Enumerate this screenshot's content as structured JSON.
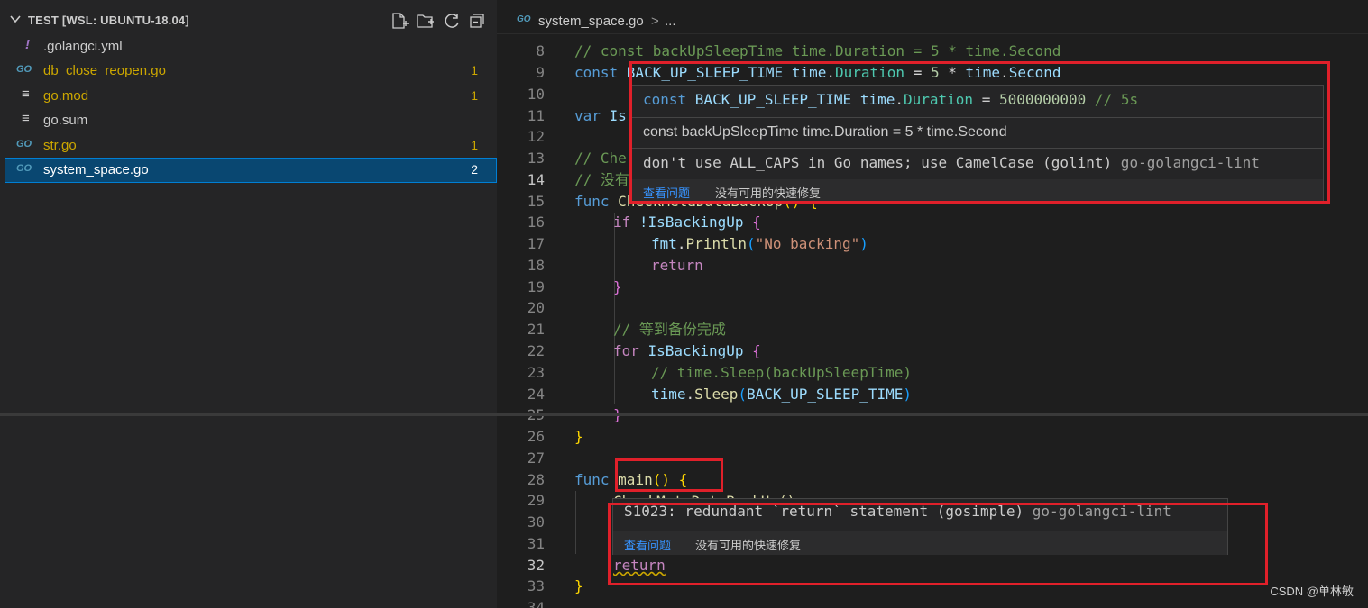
{
  "explorer": {
    "title": "TEST [WSL: UBUNTU-18.04]",
    "files": [
      {
        "icon": "!",
        "name": ".golangci.yml",
        "badge": "",
        "color": "#cccccc"
      },
      {
        "icon": "GO",
        "name": "db_close_reopen.go",
        "badge": "1",
        "color": "#cca700"
      },
      {
        "icon": "≡",
        "name": "go.mod",
        "badge": "1",
        "color": "#cca700"
      },
      {
        "icon": "≡",
        "name": "go.sum",
        "badge": "",
        "color": "#cccccc"
      },
      {
        "icon": "GO",
        "name": "str.go",
        "badge": "1",
        "color": "#cca700"
      },
      {
        "icon": "GO",
        "name": "system_space.go",
        "badge": "2",
        "color": "#ffffff"
      }
    ]
  },
  "tab": {
    "go_icon": "GO",
    "filename": "system_space.go",
    "separator": ">",
    "ellipsis": "..."
  },
  "line_numbers": [
    "8",
    "9",
    "10",
    "11",
    "12",
    "13",
    "14",
    "15",
    "16",
    "17",
    "18",
    "19",
    "20",
    "21",
    "22",
    "23",
    "24",
    "25",
    "26",
    "27",
    "28",
    "29",
    "30",
    "31",
    "32",
    "33",
    "34"
  ],
  "code": {
    "l8": "// const backUpSleepTime time.Duration = 5 * time.Second",
    "l9_kw": "const ",
    "l9_name": "BACK_UP_SLEEP_TIME",
    "l9_type_pkg": "time",
    "l9_type": "Duration",
    "l9_eq": " = ",
    "l9_num": "5",
    "l9_mul": " * ",
    "l9_pkg": "time",
    "l9_sec": "Second",
    "l11_kw": "var ",
    "l11_name": "Is",
    "l13": "// Che",
    "l14": "// 没有",
    "l15_kw": "func ",
    "l15_name": "CheckMetaDataBackUp",
    "l15_rest": "() {",
    "l16_kw": "if ",
    "l16_rest": "!IsBackingUp ",
    "l16_brace": "{",
    "l17_pkg": "fmt",
    "l17_fn": "Println",
    "l17_str": "\"No backing\"",
    "l18": "return",
    "l19": "}",
    "l21": "// 等到备份完成",
    "l22_kw": "for ",
    "l22_name": "IsBackingUp ",
    "l22_brace": "{",
    "l23": "// time.Sleep(backUpSleepTime)",
    "l24_pkg": "time",
    "l24_fn": "Sleep",
    "l24_arg": "BACK_UP_SLEEP_TIME",
    "l25": "}",
    "l26": "}",
    "l28_kw": "func ",
    "l28_fn": "main",
    "l28_paren": "()",
    "l28_brace": "{",
    "l29": "CheckMetaDataBackUp()",
    "l32": "return",
    "l33": "}"
  },
  "hover1": {
    "sig_kw": "const ",
    "sig_name": "BACK_UP_SLEEP_TIME ",
    "sig_type_pkg": "time",
    "sig_type": "Duration",
    "sig_eq": " = ",
    "sig_num": "5000000000",
    "sig_comment": " // 5s",
    "doc": "const backUpSleepTime time.Duration = 5 * time.Second",
    "problem": "don't use ALL_CAPS in Go names; use CamelCase (golint)",
    "source": " go-golangci-lint",
    "view_problem": "查看问题",
    "no_fix": "没有可用的快速修复"
  },
  "hover2": {
    "problem": "S1023: redundant `return` statement (gosimple)",
    "source": " go-golangci-lint",
    "view_problem": "查看问题",
    "no_fix": "没有可用的快速修复"
  },
  "watermark": "CSDN @单林敏",
  "colors": {
    "annotation_red": "#e0202a",
    "selection_blue": "#094771",
    "modified_yellow": "#cca700"
  }
}
